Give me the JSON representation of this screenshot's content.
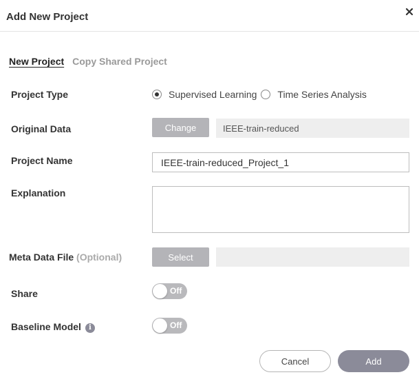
{
  "dialog": {
    "title": "Add New Project",
    "close_icon": "close-icon"
  },
  "tabs": {
    "new_project": "New Project",
    "copy_shared": "Copy Shared Project"
  },
  "fields": {
    "project_type": {
      "label": "Project Type",
      "options": [
        {
          "label": "Supervised Learning",
          "checked": true
        },
        {
          "label": "Time Series Analysis",
          "checked": false
        }
      ]
    },
    "original_data": {
      "label": "Original Data",
      "button": "Change",
      "value": "IEEE-train-reduced"
    },
    "project_name": {
      "label": "Project Name",
      "value": "IEEE-train-reduced_Project_1"
    },
    "explanation": {
      "label": "Explanation",
      "value": ""
    },
    "meta_data_file": {
      "label": "Meta Data File",
      "optional": "(Optional)",
      "button": "Select",
      "value": ""
    },
    "share": {
      "label": "Share",
      "toggle": "Off"
    },
    "baseline_model": {
      "label": "Baseline Model",
      "info_icon": "info-icon",
      "info_glyph": "i",
      "toggle": "Off"
    }
  },
  "footer": {
    "cancel": "Cancel",
    "add": "Add"
  },
  "colors": {
    "accent_button": "#8b8b99",
    "gray_button": "#b4b4b8",
    "readonly_bg": "#eeeeee"
  }
}
